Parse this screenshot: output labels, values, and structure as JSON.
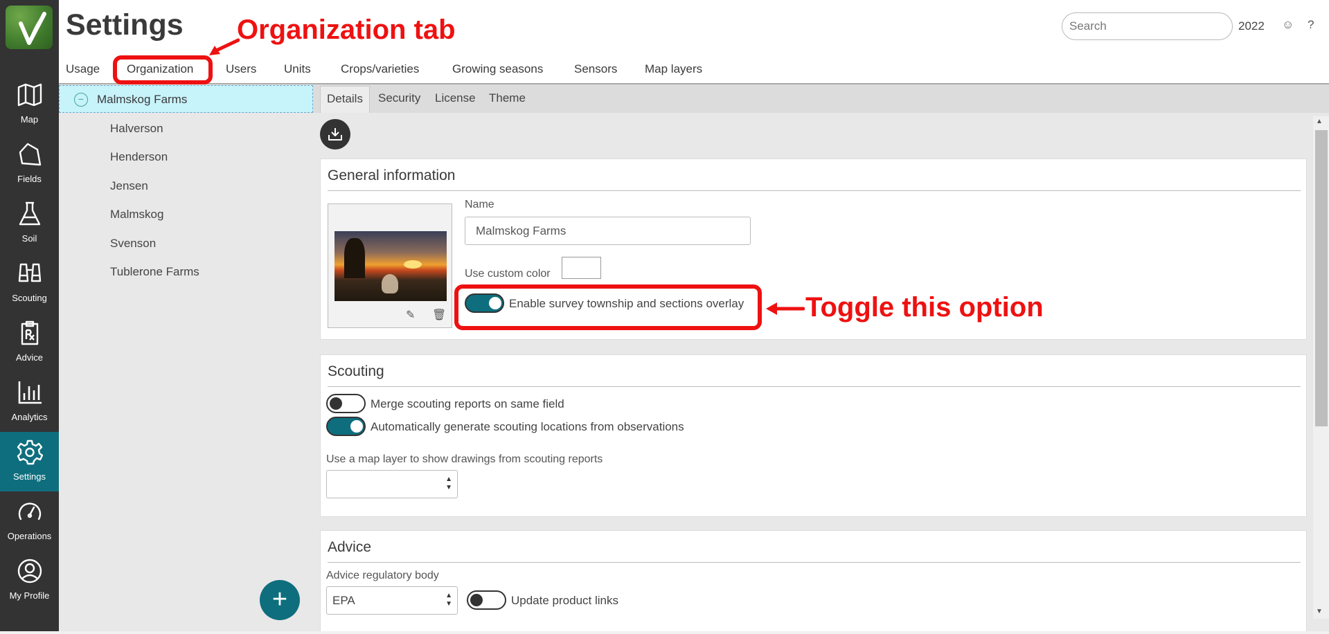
{
  "header": {
    "title": "Settings",
    "search_placeholder": "Search",
    "year": "2022",
    "feedback_icon": "smiley-icon",
    "help_icon": "question-mark-icon"
  },
  "nav": {
    "items": [
      {
        "label": "Map",
        "icon": "map-icon"
      },
      {
        "label": "Fields",
        "icon": "field-shape-icon"
      },
      {
        "label": "Soil",
        "icon": "flask-icon"
      },
      {
        "label": "Scouting",
        "icon": "binoculars-icon"
      },
      {
        "label": "Advice",
        "icon": "prescription-clipboard-icon"
      },
      {
        "label": "Analytics",
        "icon": "bar-chart-icon"
      },
      {
        "label": "Settings",
        "icon": "gear-icon"
      },
      {
        "label": "Operations",
        "icon": "gauge-icon"
      },
      {
        "label": "My Profile",
        "icon": "user-circle-icon"
      }
    ],
    "active": "Settings"
  },
  "tabs": [
    "Usage",
    "Organization",
    "Users",
    "Units",
    "Crops/varieties",
    "Growing seasons",
    "Sensors",
    "Map layers"
  ],
  "active_tab": "Organization",
  "tree": {
    "root": "Malmskog Farms",
    "collapse_symbol": "−",
    "children": [
      "Halverson",
      "Henderson",
      "Jensen",
      "Malmskog",
      "Svenson",
      "Tublerone Farms"
    ],
    "add_button": "+"
  },
  "subtabs": [
    "Details",
    "Security",
    "License",
    "Theme"
  ],
  "active_subtab": "Details",
  "general": {
    "title": "General information",
    "name_label": "Name",
    "name_value": "Malmskog Farms",
    "custom_color_label": "Use custom color",
    "survey_toggle_label": "Enable survey township and sections overlay",
    "survey_toggle_on": true
  },
  "scouting": {
    "title": "Scouting",
    "merge_label": "Merge scouting reports on same field",
    "merge_on": false,
    "auto_label": "Automatically generate scouting locations from observations",
    "auto_on": true,
    "map_layer_label": "Use a map layer to show drawings from scouting reports",
    "map_layer_value": ""
  },
  "advice": {
    "title": "Advice",
    "regulatory_label": "Advice regulatory body",
    "regulatory_value": "EPA",
    "update_links_label": "Update product links",
    "update_links_on": false
  },
  "annotations": {
    "org_tab": "Organization tab",
    "toggle": "Toggle this option",
    "color": "#ee1111"
  }
}
